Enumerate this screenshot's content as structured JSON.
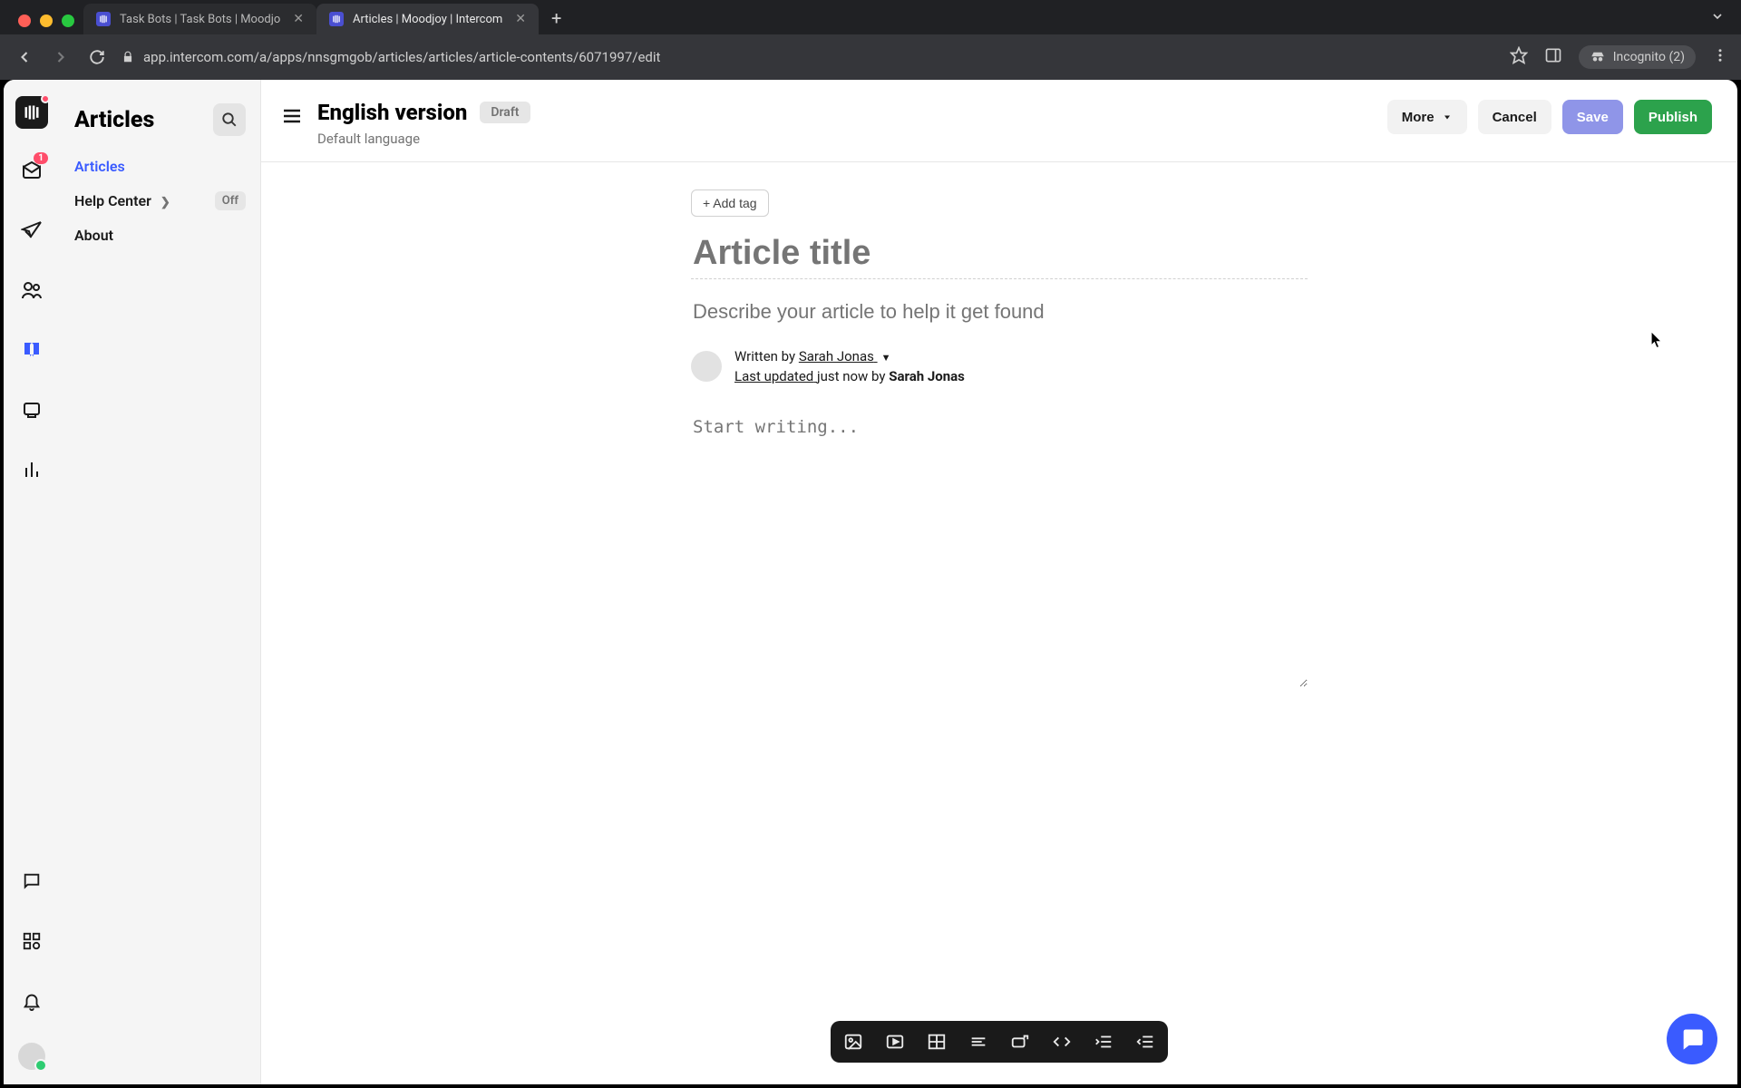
{
  "browser": {
    "tabs": [
      {
        "title": "Task Bots | Task Bots | Moodjo"
      },
      {
        "title": "Articles | Moodjoy | Intercom"
      }
    ],
    "url": "app.intercom.com/a/apps/nnsgmgob/articles/articles/article-contents/6071997/edit",
    "incognito_label": "Incognito (2)"
  },
  "rail": {
    "inbox_badge": "1"
  },
  "sidebar": {
    "heading": "Articles",
    "items": [
      {
        "label": "Articles",
        "active": true
      },
      {
        "label": "Help Center",
        "badge": "Off"
      },
      {
        "label": "About"
      }
    ]
  },
  "header": {
    "title": "English version",
    "status": "Draft",
    "subtitle": "Default language",
    "more": "More",
    "cancel": "Cancel",
    "save": "Save",
    "publish": "Publish"
  },
  "editor": {
    "add_tag": "+ Add tag",
    "title_placeholder": "Article title",
    "desc_placeholder": "Describe your article to help it get found",
    "written_by_prefix": "Written by ",
    "author": "Sarah Jonas",
    "last_updated_label": "Last updated",
    "last_updated_suffix": " just now by ",
    "updated_by": "Sarah Jonas",
    "body_placeholder": "Start writing..."
  }
}
